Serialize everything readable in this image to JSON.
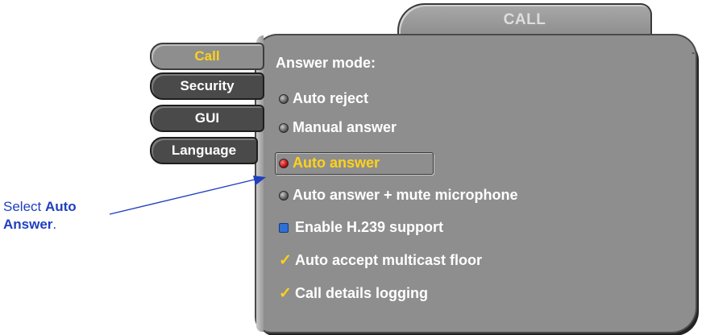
{
  "header": {
    "title": "CALL"
  },
  "tabs": [
    {
      "label": "Call",
      "active": true
    },
    {
      "label": "Security",
      "active": false
    },
    {
      "label": "GUI",
      "active": false
    },
    {
      "label": "Language",
      "active": false
    }
  ],
  "answer_mode": {
    "title": "Answer mode:",
    "options": [
      {
        "label": "Auto reject",
        "selected": false
      },
      {
        "label": "Manual answer",
        "selected": false
      },
      {
        "label": "Auto answer",
        "selected": true
      },
      {
        "label": "Auto answer + mute microphone",
        "selected": false
      }
    ]
  },
  "settings": [
    {
      "label": "Enable H.239 support",
      "checked": false
    },
    {
      "label": "Auto accept multicast floor",
      "checked": true
    },
    {
      "label": "Call details logging",
      "checked": true
    }
  ],
  "callout": {
    "prefix": "Select ",
    "strong1": "Auto",
    "strong2": "Answer",
    "suffix": "."
  },
  "margin_mark": "-",
  "colors": {
    "panel": "#8e8e8e",
    "accent_yellow": "#ffd21a",
    "callout_blue": "#1f3fbf",
    "radio_on": "#b00000"
  }
}
